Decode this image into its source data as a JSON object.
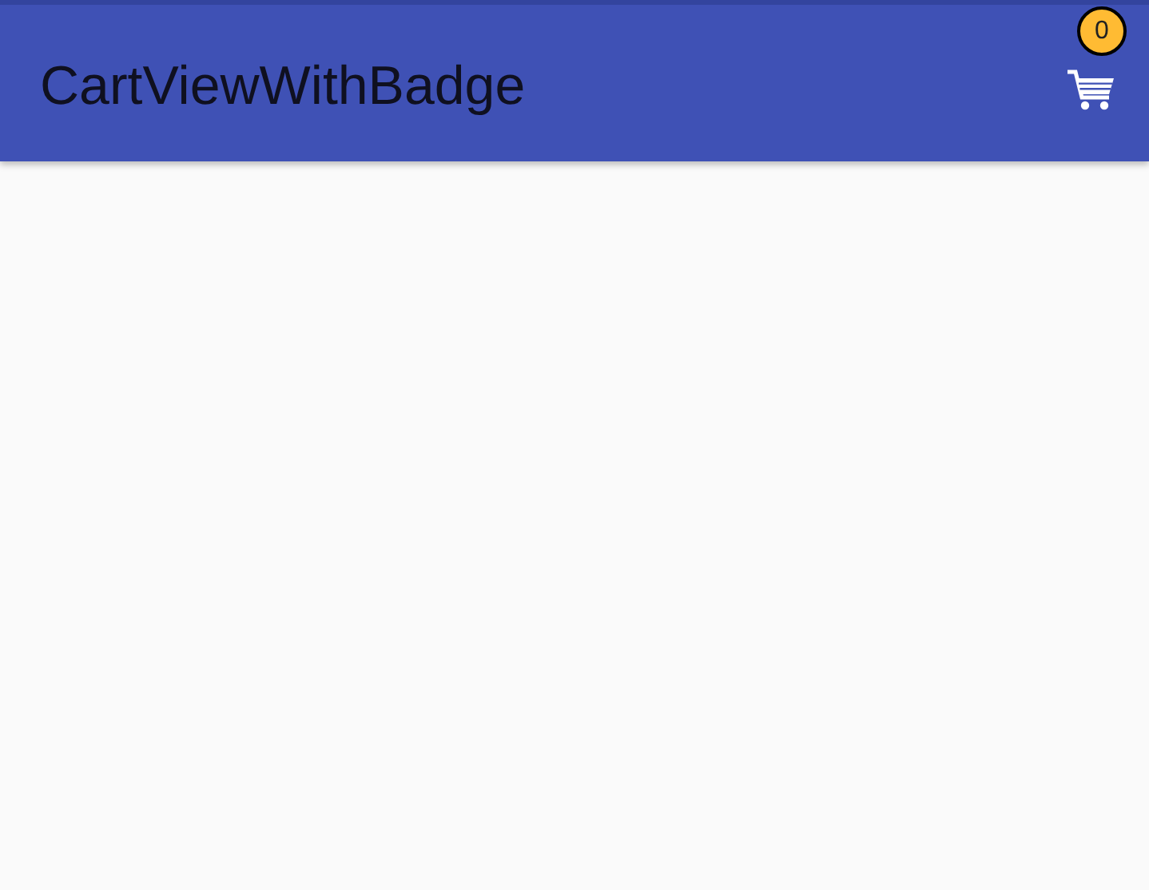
{
  "app_bar": {
    "title": "CartViewWithBadge",
    "cart_badge": "0"
  }
}
